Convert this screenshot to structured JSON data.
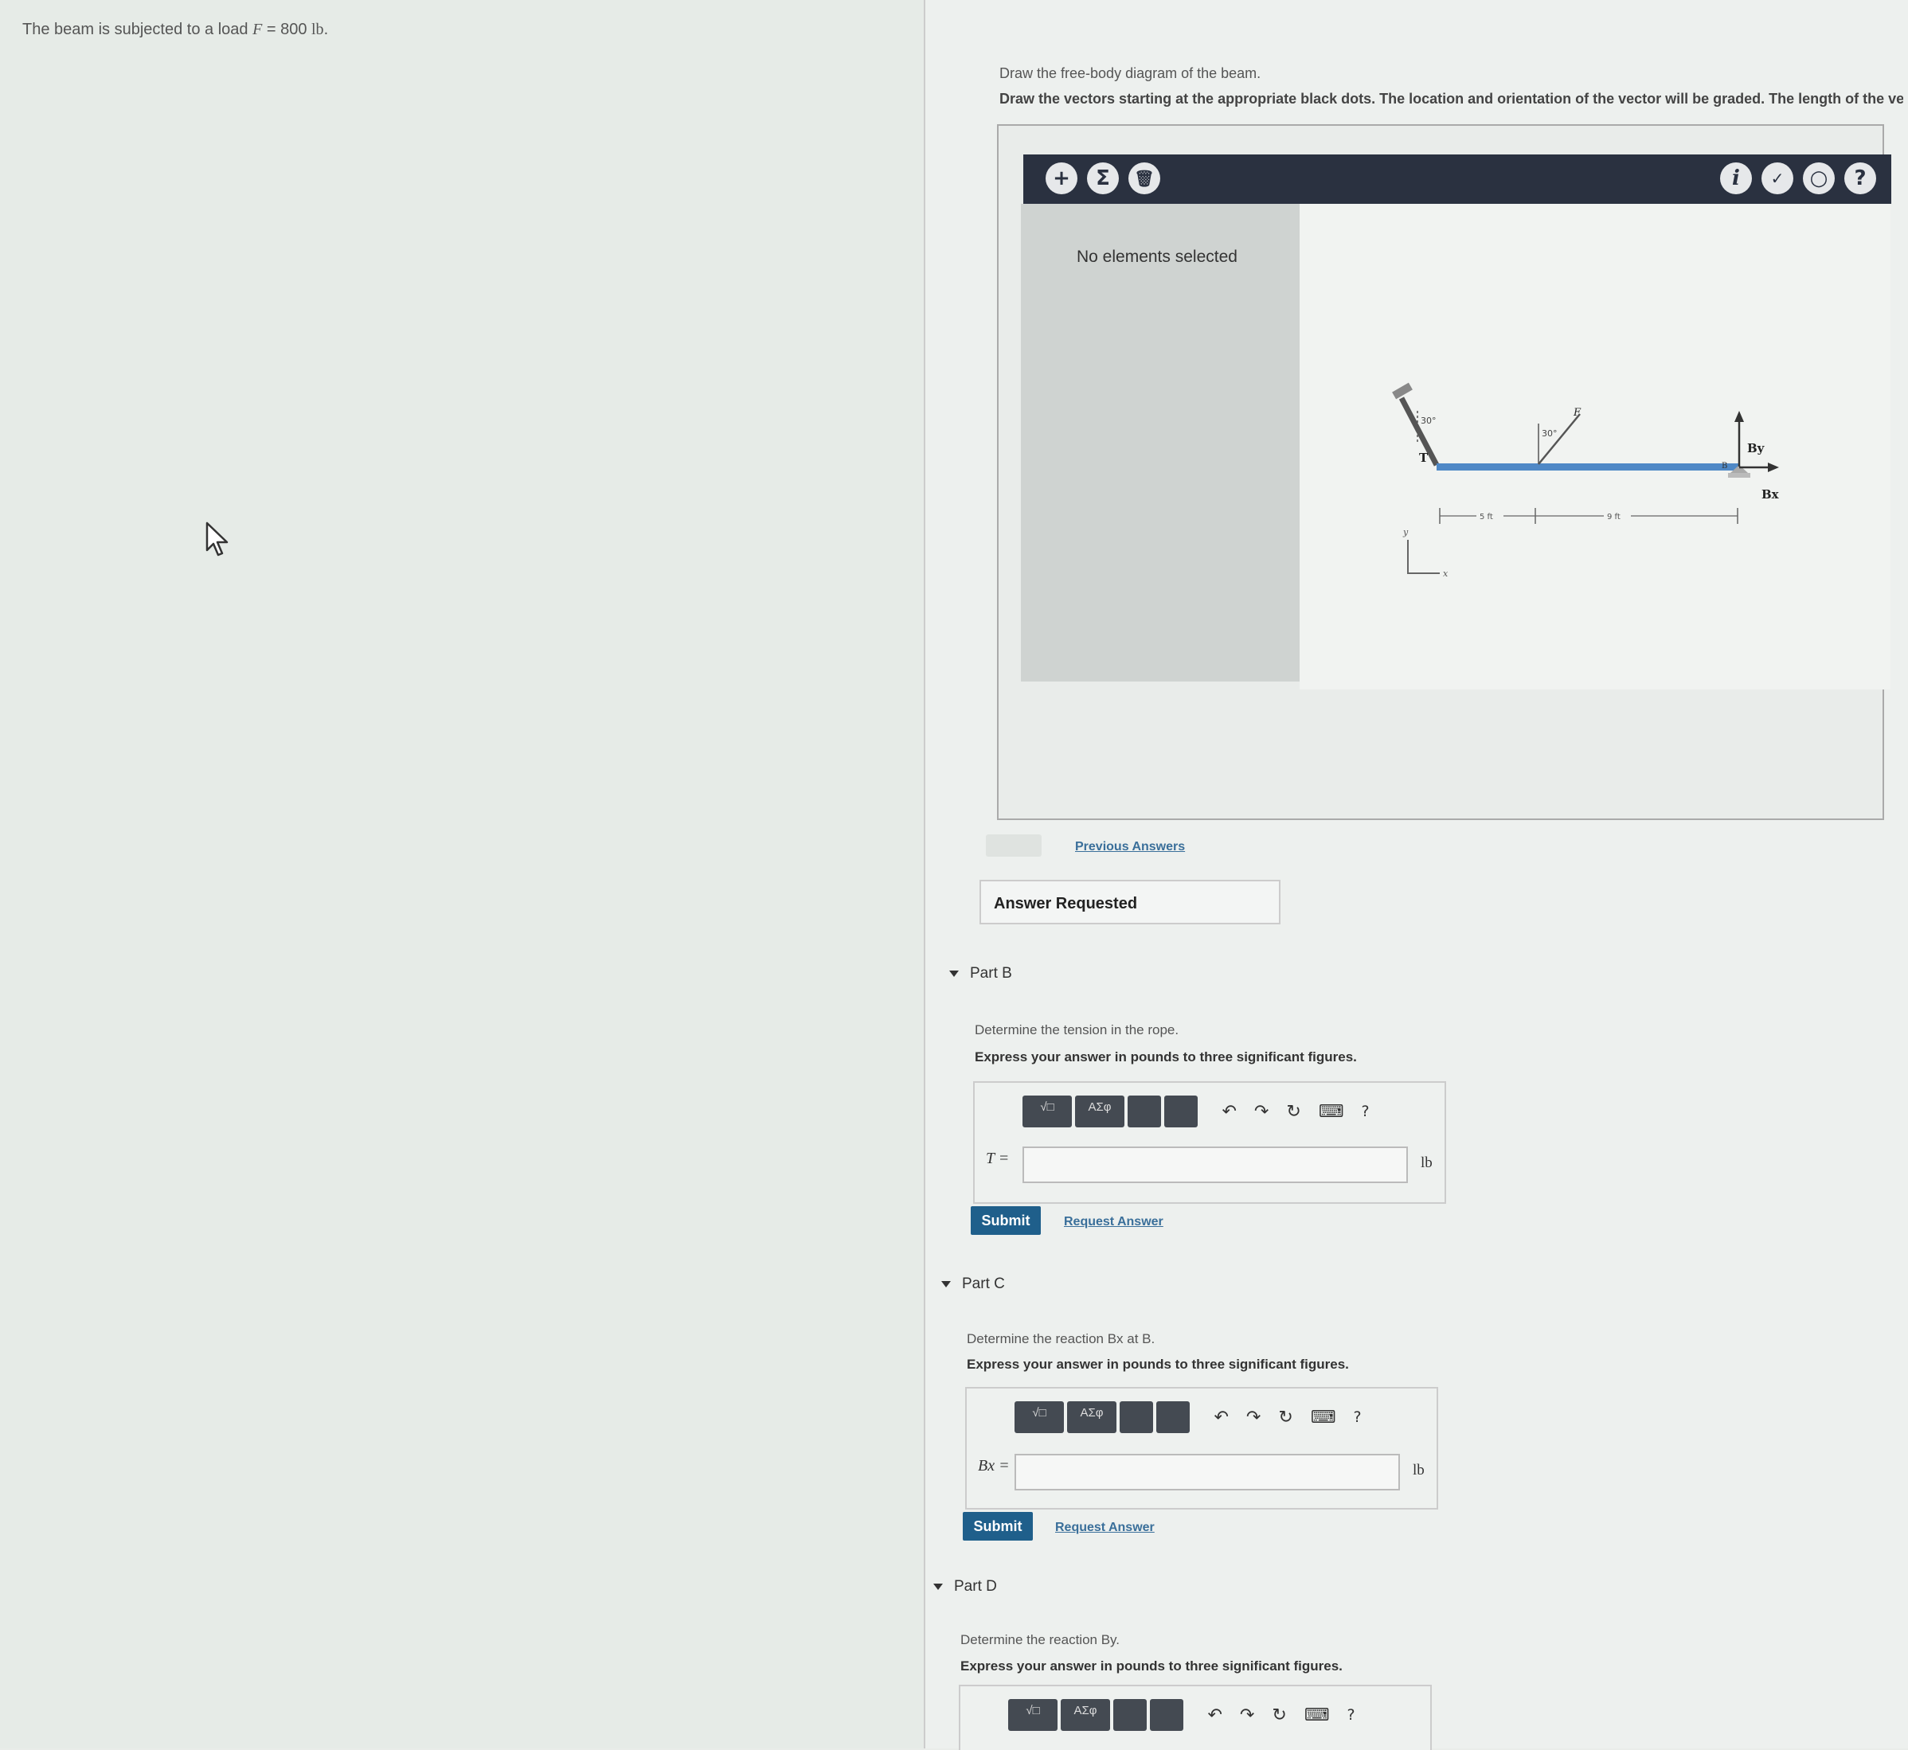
{
  "problem": {
    "prefix": "The beam is subjected to a load ",
    "var": "F",
    "eq": " = 800 ",
    "unit": "lb",
    "suffix": "."
  },
  "part_a": {
    "instruction": "Draw the free-body diagram of the beam.",
    "instruction_bold": "Draw the vectors starting at the appropriate black dots. The location and orientation of the vector will be graded. The length of the vec",
    "toolbar": {
      "add": "+",
      "sum": "Σ",
      "trash": "🗑",
      "info": "i",
      "check": "✓",
      "reset": "○",
      "help": "?"
    },
    "no_selection": "No elements selected",
    "diagram": {
      "T": "T",
      "F": "F",
      "By": "By",
      "Bx": "Bx",
      "B": "B",
      "a1": "30°",
      "a2": "30°",
      "d1": "5 ft",
      "d2": "9 ft",
      "y": "y",
      "x": "x"
    },
    "previous_answers": "Previous Answers",
    "answer_requested": "Answer Requested"
  },
  "parts": [
    {
      "title": "Part B",
      "question": "Determine the tension in the rope.",
      "express": "Express your answer in pounds to three significant figures.",
      "var": "T =",
      "unit": "lb",
      "submit": "Submit",
      "request": "Request Answer"
    },
    {
      "title": "Part C",
      "question": "Determine the reaction Bx at B.",
      "express": "Express your answer in pounds to three significant figures.",
      "var": "Bx =",
      "unit": "lb",
      "submit": "Submit",
      "request": "Request Answer"
    },
    {
      "title": "Part D",
      "question": "Determine the reaction By.",
      "express": "Express your answer in pounds to three significant figures."
    }
  ],
  "math_toolbar": {
    "templates": "√□",
    "symbols": "ΑΣφ",
    "undo": "↶",
    "redo": "↷",
    "reset": "↻",
    "keyboard": "⌨",
    "help": "?"
  }
}
